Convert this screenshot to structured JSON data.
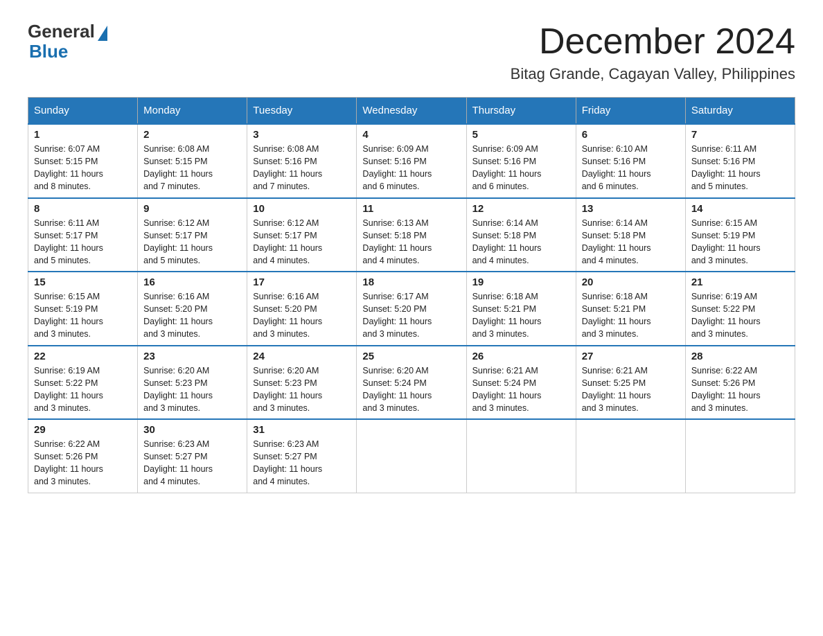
{
  "logo": {
    "general": "General",
    "blue": "Blue"
  },
  "header": {
    "month_year": "December 2024",
    "location": "Bitag Grande, Cagayan Valley, Philippines"
  },
  "weekdays": [
    "Sunday",
    "Monday",
    "Tuesday",
    "Wednesday",
    "Thursday",
    "Friday",
    "Saturday"
  ],
  "weeks": [
    [
      {
        "day": "1",
        "sunrise": "6:07 AM",
        "sunset": "5:15 PM",
        "daylight": "11 hours and 8 minutes."
      },
      {
        "day": "2",
        "sunrise": "6:08 AM",
        "sunset": "5:15 PM",
        "daylight": "11 hours and 7 minutes."
      },
      {
        "day": "3",
        "sunrise": "6:08 AM",
        "sunset": "5:16 PM",
        "daylight": "11 hours and 7 minutes."
      },
      {
        "day": "4",
        "sunrise": "6:09 AM",
        "sunset": "5:16 PM",
        "daylight": "11 hours and 6 minutes."
      },
      {
        "day": "5",
        "sunrise": "6:09 AM",
        "sunset": "5:16 PM",
        "daylight": "11 hours and 6 minutes."
      },
      {
        "day": "6",
        "sunrise": "6:10 AM",
        "sunset": "5:16 PM",
        "daylight": "11 hours and 6 minutes."
      },
      {
        "day": "7",
        "sunrise": "6:11 AM",
        "sunset": "5:16 PM",
        "daylight": "11 hours and 5 minutes."
      }
    ],
    [
      {
        "day": "8",
        "sunrise": "6:11 AM",
        "sunset": "5:17 PM",
        "daylight": "11 hours and 5 minutes."
      },
      {
        "day": "9",
        "sunrise": "6:12 AM",
        "sunset": "5:17 PM",
        "daylight": "11 hours and 5 minutes."
      },
      {
        "day": "10",
        "sunrise": "6:12 AM",
        "sunset": "5:17 PM",
        "daylight": "11 hours and 4 minutes."
      },
      {
        "day": "11",
        "sunrise": "6:13 AM",
        "sunset": "5:18 PM",
        "daylight": "11 hours and 4 minutes."
      },
      {
        "day": "12",
        "sunrise": "6:14 AM",
        "sunset": "5:18 PM",
        "daylight": "11 hours and 4 minutes."
      },
      {
        "day": "13",
        "sunrise": "6:14 AM",
        "sunset": "5:18 PM",
        "daylight": "11 hours and 4 minutes."
      },
      {
        "day": "14",
        "sunrise": "6:15 AM",
        "sunset": "5:19 PM",
        "daylight": "11 hours and 3 minutes."
      }
    ],
    [
      {
        "day": "15",
        "sunrise": "6:15 AM",
        "sunset": "5:19 PM",
        "daylight": "11 hours and 3 minutes."
      },
      {
        "day": "16",
        "sunrise": "6:16 AM",
        "sunset": "5:20 PM",
        "daylight": "11 hours and 3 minutes."
      },
      {
        "day": "17",
        "sunrise": "6:16 AM",
        "sunset": "5:20 PM",
        "daylight": "11 hours and 3 minutes."
      },
      {
        "day": "18",
        "sunrise": "6:17 AM",
        "sunset": "5:20 PM",
        "daylight": "11 hours and 3 minutes."
      },
      {
        "day": "19",
        "sunrise": "6:18 AM",
        "sunset": "5:21 PM",
        "daylight": "11 hours and 3 minutes."
      },
      {
        "day": "20",
        "sunrise": "6:18 AM",
        "sunset": "5:21 PM",
        "daylight": "11 hours and 3 minutes."
      },
      {
        "day": "21",
        "sunrise": "6:19 AM",
        "sunset": "5:22 PM",
        "daylight": "11 hours and 3 minutes."
      }
    ],
    [
      {
        "day": "22",
        "sunrise": "6:19 AM",
        "sunset": "5:22 PM",
        "daylight": "11 hours and 3 minutes."
      },
      {
        "day": "23",
        "sunrise": "6:20 AM",
        "sunset": "5:23 PM",
        "daylight": "11 hours and 3 minutes."
      },
      {
        "day": "24",
        "sunrise": "6:20 AM",
        "sunset": "5:23 PM",
        "daylight": "11 hours and 3 minutes."
      },
      {
        "day": "25",
        "sunrise": "6:20 AM",
        "sunset": "5:24 PM",
        "daylight": "11 hours and 3 minutes."
      },
      {
        "day": "26",
        "sunrise": "6:21 AM",
        "sunset": "5:24 PM",
        "daylight": "11 hours and 3 minutes."
      },
      {
        "day": "27",
        "sunrise": "6:21 AM",
        "sunset": "5:25 PM",
        "daylight": "11 hours and 3 minutes."
      },
      {
        "day": "28",
        "sunrise": "6:22 AM",
        "sunset": "5:26 PM",
        "daylight": "11 hours and 3 minutes."
      }
    ],
    [
      {
        "day": "29",
        "sunrise": "6:22 AM",
        "sunset": "5:26 PM",
        "daylight": "11 hours and 3 minutes."
      },
      {
        "day": "30",
        "sunrise": "6:23 AM",
        "sunset": "5:27 PM",
        "daylight": "11 hours and 4 minutes."
      },
      {
        "day": "31",
        "sunrise": "6:23 AM",
        "sunset": "5:27 PM",
        "daylight": "11 hours and 4 minutes."
      },
      null,
      null,
      null,
      null
    ]
  ],
  "labels": {
    "sunrise_prefix": "Sunrise: ",
    "sunset_prefix": "Sunset: ",
    "daylight_prefix": "Daylight: "
  }
}
